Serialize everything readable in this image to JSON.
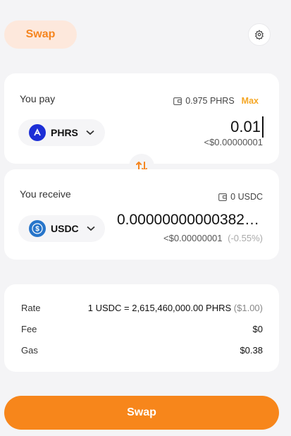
{
  "tab": {
    "label": "Swap"
  },
  "pay": {
    "label": "You pay",
    "balance": "0.975 PHRS",
    "max_label": "Max",
    "token": "PHRS",
    "amount": "0.01",
    "usd_value": "<$0.00000001"
  },
  "receive": {
    "label": "You receive",
    "balance": "0 USDC",
    "token": "USDC",
    "amount": "0.00000000000382…",
    "usd_value": "<$0.00000001",
    "price_impact": "(-0.55%)"
  },
  "info": {
    "rate_label": "Rate",
    "rate_value": "1 USDC = 2,615,460,000.00 PHRS",
    "rate_usd": "($1.00)",
    "fee_label": "Fee",
    "fee_value": "$0",
    "gas_label": "Gas",
    "gas_value": "$0.38"
  },
  "swap_button": {
    "label": "Swap"
  },
  "colors": {
    "accent": "#f7861b",
    "tab_bg": "#fde8dc",
    "max": "#f5a623",
    "phrs_icon": "#1d2fd6",
    "usdc_icon": "#2775ca"
  }
}
